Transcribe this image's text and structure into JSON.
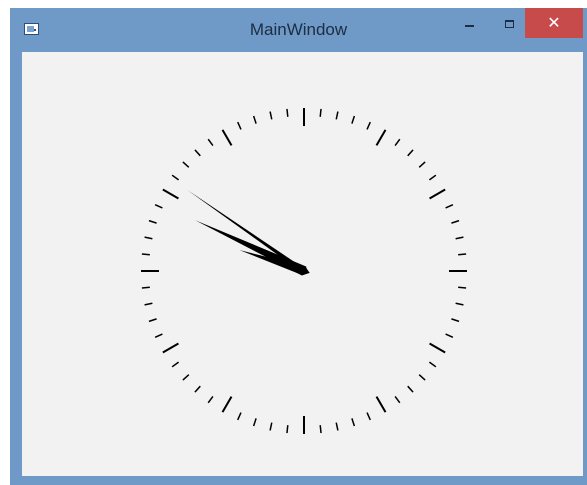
{
  "window": {
    "title": "MainWindow",
    "titlebar_color": "#6f99c6",
    "close_color": "#c84b4b",
    "client_background": "#f2f2f3"
  },
  "controls": {
    "minimize_icon": "minimize-icon",
    "maximize_icon": "maximize-icon",
    "close_glyph": "✕"
  },
  "clock": {
    "time": {
      "hour": 9,
      "minute": 50,
      "second": 48
    },
    "minute_ticks": 60,
    "major_tick_every": 5,
    "tick_color": "#000000",
    "hand_color": "#000000"
  }
}
